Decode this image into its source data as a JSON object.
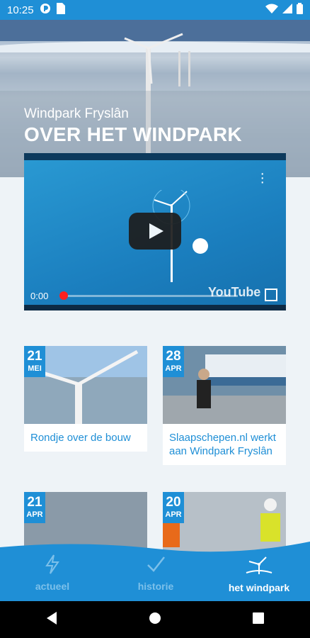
{
  "status": {
    "time": "10:25"
  },
  "hero": {
    "subtitle": "Windpark Fryslân",
    "title": "OVER HET WINDPARK"
  },
  "video": {
    "time": "0:00",
    "brand": "YouTube"
  },
  "cards": [
    {
      "day": "21",
      "month": "MEI",
      "title": "Rondje over de bouw"
    },
    {
      "day": "28",
      "month": "APR",
      "title": "Slaapschepen.nl werkt aan Windpark Fryslân"
    },
    {
      "day": "21",
      "month": "APR",
      "title": ""
    },
    {
      "day": "20",
      "month": "APR",
      "title": ""
    }
  ],
  "nav": {
    "items": [
      {
        "label": "actueel",
        "icon": "lightning-icon"
      },
      {
        "label": "historie",
        "icon": "check-icon"
      },
      {
        "label": "het windpark",
        "icon": "windpark-icon"
      }
    ],
    "active": "het windpark"
  },
  "colors": {
    "brand": "#1f8fd6",
    "nav_inactive": "#7cc0ea",
    "background": "#eef3f7"
  }
}
